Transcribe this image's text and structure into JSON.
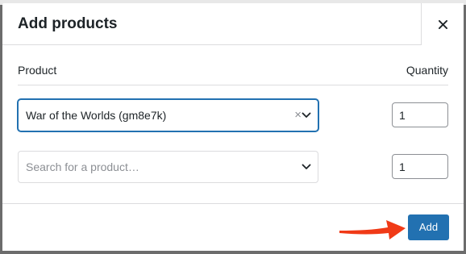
{
  "modal": {
    "title": "Add products",
    "close_icon": "close-icon"
  },
  "table": {
    "product_header": "Product",
    "quantity_header": "Quantity"
  },
  "rows": [
    {
      "product": "War of the Worlds (gm8e7k)",
      "clear_symbol": "×",
      "quantity": "1"
    },
    {
      "placeholder": "Search for a product…",
      "quantity": "1"
    }
  ],
  "footer": {
    "add_label": "Add"
  },
  "colors": {
    "accent": "#2271b1",
    "arrow": "#f03a17"
  }
}
